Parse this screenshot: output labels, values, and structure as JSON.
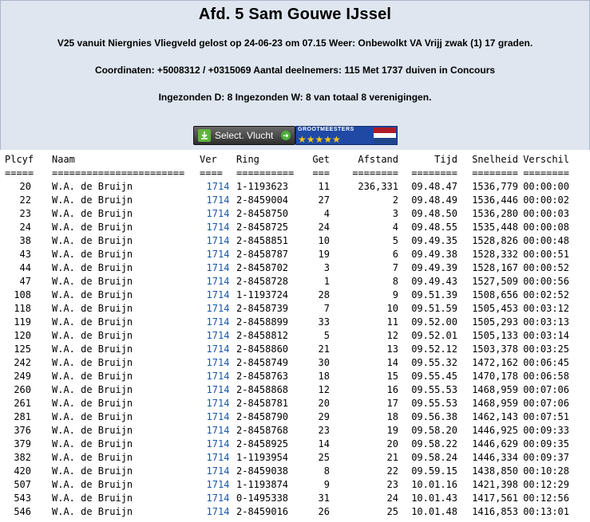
{
  "header": {
    "title": "Afd. 5 Sam Gouwe IJssel",
    "line1": "V25 vanuit Niergnies Vliegveld gelost op 24-06-23 om 07.15 Weer: Onbewolkt VA Vrijj zwak (1) 17 graden.",
    "line2": "Coordinaten: +5008312 / +0315069 Aantal deelnemers: 115 Met 1737 duiven in Concours",
    "line3": "Ingezonden D: 8 Ingezonden W: 8 van totaal 8 verenigingen."
  },
  "toolbar": {
    "select_label": "Select. Vlucht",
    "badge_text": "GROOTMEESTERS",
    "badge_stars": "★★★★★",
    "flag_colors": [
      "#ae1c28",
      "#ffffff",
      "#21468b"
    ]
  },
  "columns": [
    "Plcyf",
    "Naam",
    "Ver",
    "Ring",
    "Get",
    "Afstand",
    "Tijd",
    "Snelheid",
    "Verschil"
  ],
  "separators": [
    "=====",
    "=======================",
    "====",
    "==========",
    "===",
    "========",
    "========",
    "========",
    "========"
  ],
  "rows": [
    [
      "20",
      "W.A. de Bruijn",
      "1714",
      "1-1193623",
      "11",
      "236,331",
      "09.48.47",
      "1536,779",
      "00:00:00"
    ],
    [
      "22",
      "W.A. de Bruijn",
      "1714",
      "2-8459004",
      "27",
      "2",
      "09.48.49",
      "1536,446",
      "00:00:02"
    ],
    [
      "23",
      "W.A. de Bruijn",
      "1714",
      "2-8458750",
      "4",
      "3",
      "09.48.50",
      "1536,280",
      "00:00:03"
    ],
    [
      "24",
      "W.A. de Bruijn",
      "1714",
      "2-8458725",
      "24",
      "4",
      "09.48.55",
      "1535,448",
      "00:00:08"
    ],
    [
      "38",
      "W.A. de Bruijn",
      "1714",
      "2-8458851",
      "10",
      "5",
      "09.49.35",
      "1528,826",
      "00:00:48"
    ],
    [
      "43",
      "W.A. de Bruijn",
      "1714",
      "2-8458787",
      "19",
      "6",
      "09.49.38",
      "1528,332",
      "00:00:51"
    ],
    [
      "44",
      "W.A. de Bruijn",
      "1714",
      "2-8458702",
      "3",
      "7",
      "09.49.39",
      "1528,167",
      "00:00:52"
    ],
    [
      "47",
      "W.A. de Bruijn",
      "1714",
      "2-8458728",
      "1",
      "8",
      "09.49.43",
      "1527,509",
      "00:00:56"
    ],
    [
      "108",
      "W.A. de Bruijn",
      "1714",
      "1-1193724",
      "28",
      "9",
      "09.51.39",
      "1508,656",
      "00:02:52"
    ],
    [
      "118",
      "W.A. de Bruijn",
      "1714",
      "2-8458739",
      "7",
      "10",
      "09.51.59",
      "1505,453",
      "00:03:12"
    ],
    [
      "119",
      "W.A. de Bruijn",
      "1714",
      "2-8458899",
      "33",
      "11",
      "09.52.00",
      "1505,293",
      "00:03:13"
    ],
    [
      "120",
      "W.A. de Bruijn",
      "1714",
      "2-8458812",
      "5",
      "12",
      "09.52.01",
      "1505,133",
      "00:03:14"
    ],
    [
      "125",
      "W.A. de Bruijn",
      "1714",
      "2-8458860",
      "21",
      "13",
      "09.52.12",
      "1503,378",
      "00:03:25"
    ],
    [
      "242",
      "W.A. de Bruijn",
      "1714",
      "2-8458749",
      "30",
      "14",
      "09.55.32",
      "1472,162",
      "00:06:45"
    ],
    [
      "249",
      "W.A. de Bruijn",
      "1714",
      "2-8458763",
      "18",
      "15",
      "09.55.45",
      "1470,178",
      "00:06:58"
    ],
    [
      "260",
      "W.A. de Bruijn",
      "1714",
      "2-8458868",
      "12",
      "16",
      "09.55.53",
      "1468,959",
      "00:07:06"
    ],
    [
      "261",
      "W.A. de Bruijn",
      "1714",
      "2-8458781",
      "20",
      "17",
      "09.55.53",
      "1468,959",
      "00:07:06"
    ],
    [
      "281",
      "W.A. de Bruijn",
      "1714",
      "2-8458790",
      "29",
      "18",
      "09.56.38",
      "1462,143",
      "00:07:51"
    ],
    [
      "376",
      "W.A. de Bruijn",
      "1714",
      "2-8458768",
      "23",
      "19",
      "09.58.20",
      "1446,925",
      "00:09:33"
    ],
    [
      "379",
      "W.A. de Bruijn",
      "1714",
      "2-8458925",
      "14",
      "20",
      "09.58.22",
      "1446,629",
      "00:09:35"
    ],
    [
      "382",
      "W.A. de Bruijn",
      "1714",
      "1-1193954",
      "25",
      "21",
      "09.58.24",
      "1446,334",
      "00:09:37"
    ],
    [
      "420",
      "W.A. de Bruijn",
      "1714",
      "2-8459038",
      "8",
      "22",
      "09.59.15",
      "1438,850",
      "00:10:28"
    ],
    [
      "507",
      "W.A. de Bruijn",
      "1714",
      "1-1193874",
      "9",
      "23",
      "10.01.16",
      "1421,398",
      "00:12:29"
    ],
    [
      "543",
      "W.A. de Bruijn",
      "1714",
      "0-1495338",
      "31",
      "24",
      "10.01.43",
      "1417,561",
      "00:12:56"
    ],
    [
      "546",
      "W.A. de Bruijn",
      "1714",
      "2-8459016",
      "26",
      "25",
      "10.01.48",
      "1416,853",
      "00:13:01"
    ]
  ]
}
